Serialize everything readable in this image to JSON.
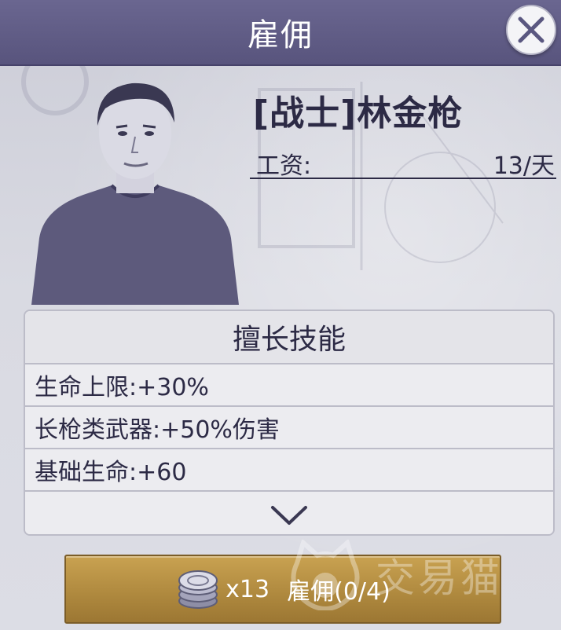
{
  "header": {
    "title": "雇佣"
  },
  "character": {
    "name": "[战士]林金枪",
    "wage_label": "工资:",
    "wage_value": "13/天"
  },
  "skills": {
    "title": "擅长技能",
    "items": [
      {
        "text": "生命上限:+30%"
      },
      {
        "text": "长枪类武器:+50%伤害"
      },
      {
        "text": "基础生命:+60"
      }
    ],
    "expand_icon": "chevron-down-icon"
  },
  "hire_button": {
    "currency_icon": "silver-coin-stack-icon",
    "count": "x13",
    "label": "雇佣(0/4)"
  },
  "watermark": {
    "text": "交易猫"
  },
  "colors": {
    "header": "#5f5b85",
    "button_gold": "#b8924a",
    "panel": "#e9e9ed",
    "text_dark": "#2c2a45"
  }
}
